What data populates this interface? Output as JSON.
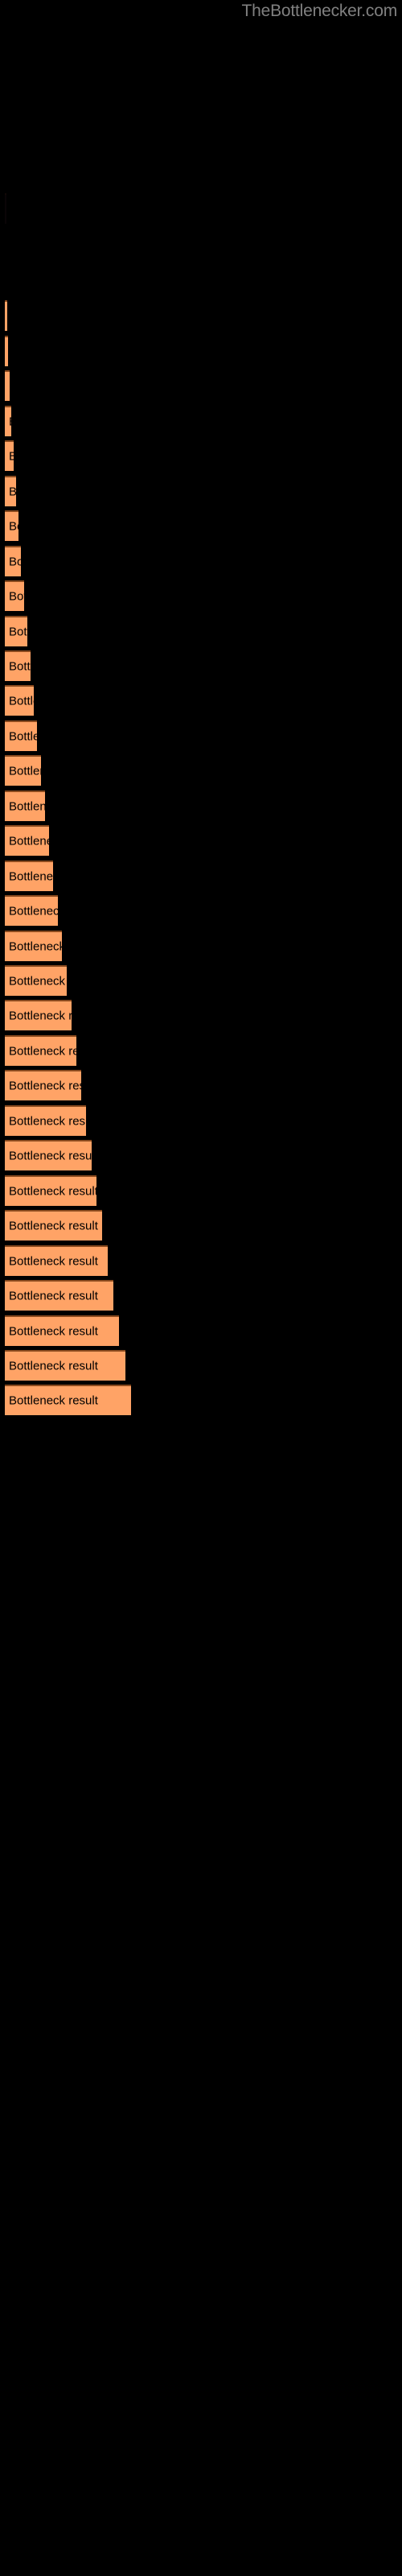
{
  "watermark": "TheBottlenecker.com",
  "background_color": "#000000",
  "bar_color": "#ffa366",
  "bar_border_color": "#8a4a1e",
  "label_color": "#000000",
  "watermark_color": "#808080",
  "bar_label": "Bottleneck result",
  "chart_data": {
    "type": "bar",
    "orientation": "horizontal",
    "title": "",
    "subtitle": "",
    "xlabel": "",
    "ylabel": "",
    "grid": false,
    "legend": null,
    "xlim": [
      0,
      500
    ],
    "categories": [
      "Bottleneck result",
      "Bottleneck result",
      "Bottleneck result",
      "Bottleneck result",
      "Bottleneck result",
      "Bottleneck result",
      "Bottleneck result",
      "Bottleneck result",
      "Bottleneck result",
      "Bottleneck result",
      "Bottleneck result",
      "Bottleneck result",
      "Bottleneck result",
      "Bottleneck result",
      "Bottleneck result",
      "Bottleneck result",
      "Bottleneck result",
      "Bottleneck result",
      "Bottleneck result",
      "Bottleneck result",
      "Bottleneck result",
      "Bottleneck result",
      "Bottleneck result",
      "Bottleneck result",
      "Bottleneck result",
      "Bottleneck result",
      "Bottleneck result",
      "Bottleneck result",
      "Bottleneck result",
      "Bottleneck result",
      "Bottleneck result",
      "Bottleneck result",
      "Bottleneck result"
    ],
    "values": [
      1,
      2,
      2,
      3,
      5,
      8,
      11,
      14,
      18,
      22,
      28,
      36,
      45,
      52,
      60,
      68,
      74,
      82,
      90,
      98,
      106,
      114,
      122,
      130,
      138,
      146,
      154,
      162,
      170,
      178,
      186,
      194,
      202
    ],
    "bars": [
      {
        "index": 0,
        "y": 240,
        "width": 2,
        "label": "Bottleneck result",
        "faint": true
      },
      {
        "index": 1,
        "y": 373,
        "width": 3,
        "label": "Bottleneck result",
        "faint": false
      },
      {
        "index": 2,
        "y": 416,
        "width": 4,
        "label": "Bottleneck result",
        "faint": false
      },
      {
        "index": 3,
        "y": 460,
        "width": 10,
        "label": "Bottleneck result",
        "faint": false
      },
      {
        "index": 4,
        "y": 503,
        "width": 16,
        "label": "Bottleneck result",
        "faint": false
      },
      {
        "index": 5,
        "y": 546,
        "width": 13,
        "label": "Bottleneck result",
        "faint": false
      },
      {
        "index": 6,
        "y": 590,
        "width": 18,
        "label": "Bottleneck result",
        "faint": false
      },
      {
        "index": 7,
        "y": 633,
        "width": 31,
        "label": "Bottleneck result",
        "faint": false
      },
      {
        "index": 8,
        "y": 676,
        "width": 55,
        "label": "Bottleneck result",
        "faint": false
      },
      {
        "index": 9,
        "y": 720,
        "width": 44,
        "label": "Bottleneck result",
        "faint": false
      },
      {
        "index": 10,
        "y": 763,
        "width": 63,
        "label": "Bottleneck result",
        "faint": false
      },
      {
        "index": 11,
        "y": 806,
        "width": 79,
        "label": "Bottleneck result",
        "faint": false
      },
      {
        "index": 12,
        "y": 850,
        "width": 56,
        "label": "Bottleneck result",
        "faint": false
      },
      {
        "index": 13,
        "y": 893,
        "width": 72,
        "label": "Bottleneck result",
        "faint": false
      },
      {
        "index": 14,
        "y": 936,
        "width": 48,
        "label": "Bottleneck result",
        "faint": false
      },
      {
        "index": 15,
        "y": 980,
        "width": 74,
        "label": "Bottleneck result",
        "faint": false
      },
      {
        "index": 16,
        "y": 1023,
        "width": 66,
        "label": "Bottleneck result",
        "faint": false
      },
      {
        "index": 17,
        "y": 1066,
        "width": 79,
        "label": "Bottleneck result",
        "faint": false
      },
      {
        "index": 18,
        "y": 1110,
        "width": 86,
        "label": "Bottleneck result",
        "faint": false
      },
      {
        "index": 19,
        "y": 1153,
        "width": 90,
        "label": "Bottleneck result",
        "faint": false
      },
      {
        "index": 20,
        "y": 1196,
        "width": 86,
        "label": "Bottleneck result",
        "faint": false
      },
      {
        "index": 21,
        "y": 1240,
        "width": 79,
        "label": "Bottleneck result",
        "faint": false
      },
      {
        "index": 22,
        "y": 1283,
        "width": 89,
        "label": "Bottleneck result",
        "faint": false
      },
      {
        "index": 23,
        "y": 1326,
        "width": 97,
        "label": "Bottleneck result",
        "faint": false
      },
      {
        "index": 24,
        "y": 1370,
        "width": 92,
        "label": "Bottleneck result",
        "faint": false
      },
      {
        "index": 25,
        "y": 1413,
        "width": 98,
        "label": "Bottleneck result",
        "faint": false
      },
      {
        "index": 26,
        "y": 1457,
        "width": 97,
        "label": "Bottleneck result",
        "faint": false
      },
      {
        "index": 27,
        "y": 1500,
        "width": 104,
        "label": "Bottleneck result",
        "faint": false
      },
      {
        "index": 28,
        "y": 1543,
        "width": 109,
        "label": "Bottleneck result",
        "faint": false
      },
      {
        "index": 29,
        "y": 1587,
        "width": 107,
        "label": "Bottleneck result",
        "faint": false
      }
    ]
  }
}
